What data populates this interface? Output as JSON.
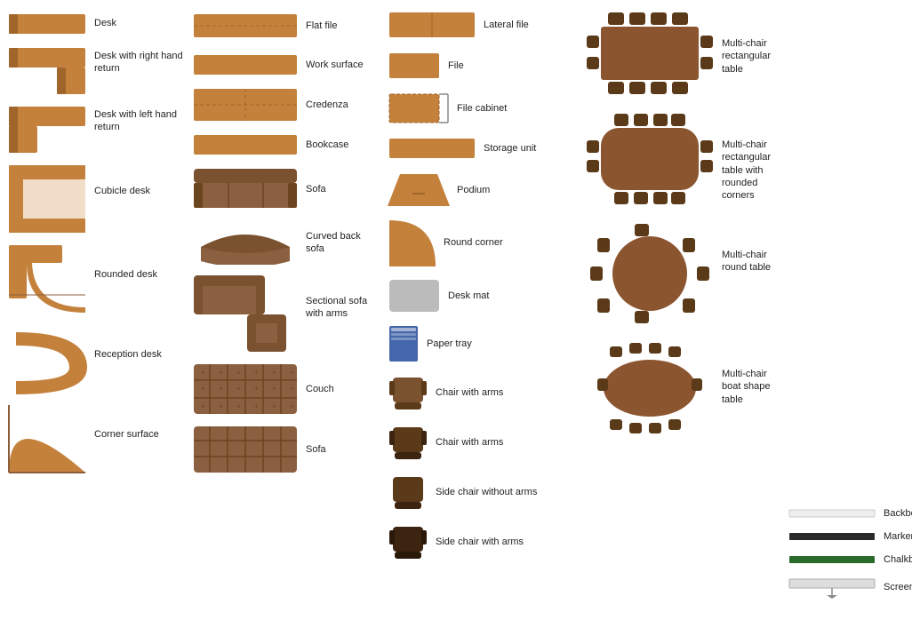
{
  "col1": {
    "items": [
      {
        "label": "Desk"
      },
      {
        "label": "Desk with right hand return"
      },
      {
        "label": "Desk with left hand return"
      },
      {
        "label": "Cubicle desk"
      },
      {
        "label": "Rounded desk"
      },
      {
        "label": "Reception desk"
      },
      {
        "label": "Corner surface"
      }
    ]
  },
  "col2": {
    "items": [
      {
        "label": "Flat file"
      },
      {
        "label": "Work surface"
      },
      {
        "label": "Credenza"
      },
      {
        "label": "Bookcase"
      },
      {
        "label": "Sofa"
      },
      {
        "label": "Curved back sofa"
      },
      {
        "label": "Sectional sofa with arms"
      },
      {
        "label": "Couch"
      },
      {
        "label": "Sofa"
      }
    ]
  },
  "col3": {
    "items": [
      {
        "label": "Lateral file"
      },
      {
        "label": "File"
      },
      {
        "label": "File cabinet"
      },
      {
        "label": "Storage unit"
      },
      {
        "label": "Podium"
      },
      {
        "label": "Round corner"
      },
      {
        "label": "Desk mat"
      },
      {
        "label": "Paper tray"
      },
      {
        "label": "Chair with arms"
      },
      {
        "label": "Chair with arms"
      },
      {
        "label": "Side chair without arms"
      },
      {
        "label": "Side chair with arms"
      }
    ]
  },
  "col4": {
    "items": [
      {
        "label": "Multi-chair rectangular table"
      },
      {
        "label": "Multi-chair rectangular table with rounded corners"
      },
      {
        "label": "Multi-chair round table"
      },
      {
        "label": "Multi-chair boat shape table"
      }
    ]
  },
  "col5": {
    "items": [
      {
        "label": "Backboard"
      },
      {
        "label": "Marker board"
      },
      {
        "label": "Chalkboard"
      },
      {
        "label": "Screen"
      }
    ]
  }
}
